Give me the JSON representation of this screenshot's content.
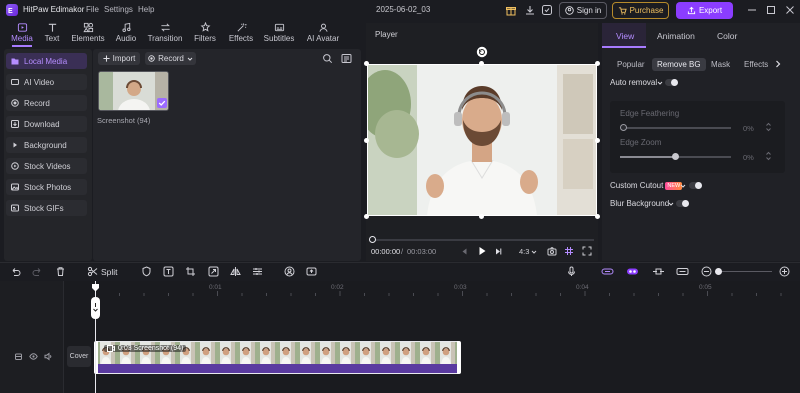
{
  "app": {
    "name": "HitPaw Edimakor",
    "menu": [
      "File",
      "Settings",
      "Help"
    ],
    "project_title": "2025-06-02_03",
    "sign_in": "Sign in",
    "purchase": "Purchase",
    "export": "Export"
  },
  "tool_tabs": [
    "Media",
    "Text",
    "Elements",
    "Audio",
    "Transition",
    "Filters",
    "Effects",
    "Subtitles",
    "AI Avatar"
  ],
  "tool_tab_active": "Media",
  "sidebar": {
    "items": [
      "Local Media",
      "AI Video",
      "Record",
      "Download",
      "Background",
      "Stock Videos",
      "Stock Photos",
      "Stock GIFs"
    ],
    "active": "Local Media"
  },
  "media": {
    "import_label": "Import",
    "record_label": "Record",
    "thumb_caption": "Screenshot (94)"
  },
  "player": {
    "title": "Player",
    "current_time": "00:00:00",
    "separator": "/",
    "total_time": "00:03:00",
    "aspect_ratio": "4:3"
  },
  "props": {
    "tabs": [
      "View",
      "Animation",
      "Color"
    ],
    "active_tab": "View",
    "subtabs": [
      "Popular",
      "Remove BG",
      "Mask",
      "Effects"
    ],
    "active_subtab": "Remove BG",
    "auto_removal": "Auto removal",
    "edge_feathering": "Edge Feathering",
    "edge_feathering_value": "0%",
    "edge_zoom": "Edge Zoom",
    "edge_zoom_value": "0%",
    "edge_zoom_level": 0.5,
    "custom_cutout": "Custom Cutout",
    "new_badge": "NEW",
    "blur_background": "Blur Background"
  },
  "timeline": {
    "split_label": "Split",
    "ruler": [
      "0:01",
      "0:02",
      "0:03",
      "0:04",
      "0:05"
    ],
    "cover_label": "Cover",
    "clip_label": "0:03 Screenshot (94)"
  },
  "colors": {
    "accent": "#a87bff",
    "export_bg": "#8b3dff",
    "purchase": "#f0c060",
    "clip_bar": "#5a3aa0"
  }
}
